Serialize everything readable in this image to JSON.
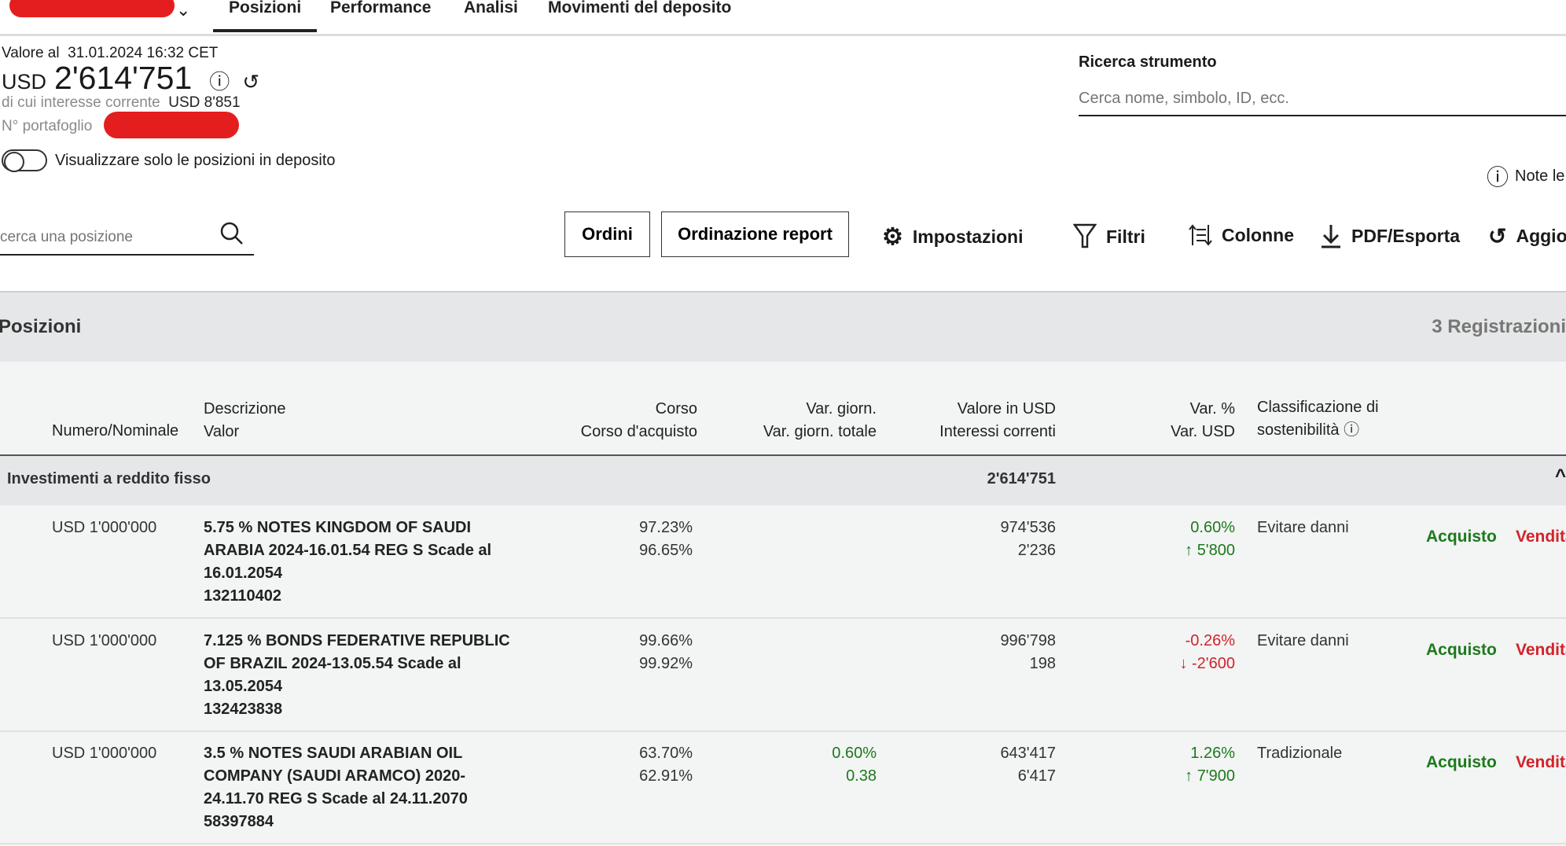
{
  "tabs": [
    {
      "label": "Posizioni",
      "active": true
    },
    {
      "label": "Performance"
    },
    {
      "label": "Analisi"
    },
    {
      "label": "Movimenti del deposito"
    }
  ],
  "summary": {
    "value_label": "Valore al",
    "timestamp": "31.01.2024 16:32 CET",
    "currency": "USD",
    "total": "2'614'751",
    "interest_label": "di cui interesse corrente",
    "interest_value": "USD  8'851",
    "portfolio_label": "N° portafoglio"
  },
  "toggle": {
    "label": "Visualizzare solo le posizioni in deposito",
    "on": false
  },
  "instrument_search": {
    "label": "Ricerca strumento",
    "placeholder": "Cerca nome, simbolo, ID, ecc."
  },
  "legal_notes": "Note le",
  "position_search": {
    "placeholder": "cerca una posizione"
  },
  "toolbar": {
    "orders": "Ordini",
    "report": "Ordinazione report",
    "settings": "Impostazioni",
    "filters": "Filtri",
    "columns": "Colonne",
    "export": "PDF/Esporta",
    "refresh": "Aggio"
  },
  "section": {
    "title": "Posizioni",
    "count": "3 Registrazioni"
  },
  "columns": {
    "nominal": "Numero/Nominale",
    "desc1": "Descrizione",
    "desc2": "Valor",
    "price1": "Corso",
    "price2": "Corso d'acquisto",
    "day1": "Var. giorn.",
    "day2": "Var. giorn. totale",
    "value1": "Valore in USD",
    "value2": "Interessi correnti",
    "var1": "Var. %",
    "var2": "Var. USD",
    "esg1": "Classificazione di",
    "esg2": "sostenibilità"
  },
  "group": {
    "name": "Investimenti a reddito fisso",
    "total": "2'614'751"
  },
  "rows": [
    {
      "nominal": "USD 1'000'000",
      "description": "5.75 % NOTES KINGDOM OF SAUDI ARABIA 2024-16.01.54 REG S Scade al 16.01.2054",
      "valor": "132110402",
      "price": "97.23%",
      "buy_price": "96.65%",
      "day_pct": "",
      "day_total": "",
      "value": "974'536",
      "interest": "2'236",
      "var_pct": "0.60%",
      "var_usd": "5'800",
      "direction": "up",
      "esg": "Evitare danni",
      "buy": "Acquisto",
      "sell": "Vendita"
    },
    {
      "nominal": "USD 1'000'000",
      "description": "7.125 % BONDS FEDERATIVE REPUBLIC OF BRAZIL 2024-13.05.54 Scade al 13.05.2054",
      "valor": "132423838",
      "price": "99.66%",
      "buy_price": "99.92%",
      "day_pct": "",
      "day_total": "",
      "value": "996'798",
      "interest": "198",
      "var_pct": "-0.26%",
      "var_usd": "-2'600",
      "direction": "down",
      "esg": "Evitare danni",
      "buy": "Acquisto",
      "sell": "Vendita"
    },
    {
      "nominal": "USD 1'000'000",
      "description": "3.5 % NOTES SAUDI ARABIAN OIL COMPANY (SAUDI ARAMCO) 2020-24.11.70 REG S Scade al 24.11.2070",
      "valor": "58397884",
      "price": "63.70%",
      "buy_price": "62.91%",
      "day_pct": "0.60%",
      "day_total": "0.38",
      "value": "643'417",
      "interest": "6'417",
      "var_pct": "1.26%",
      "var_usd": "7'900",
      "direction": "up",
      "esg": "Tradizionale",
      "buy": "Acquisto",
      "sell": "Vendita"
    }
  ],
  "colors": {
    "positive": "#1c7a1c",
    "negative": "#d2232a",
    "band": "#e6e7e8"
  }
}
